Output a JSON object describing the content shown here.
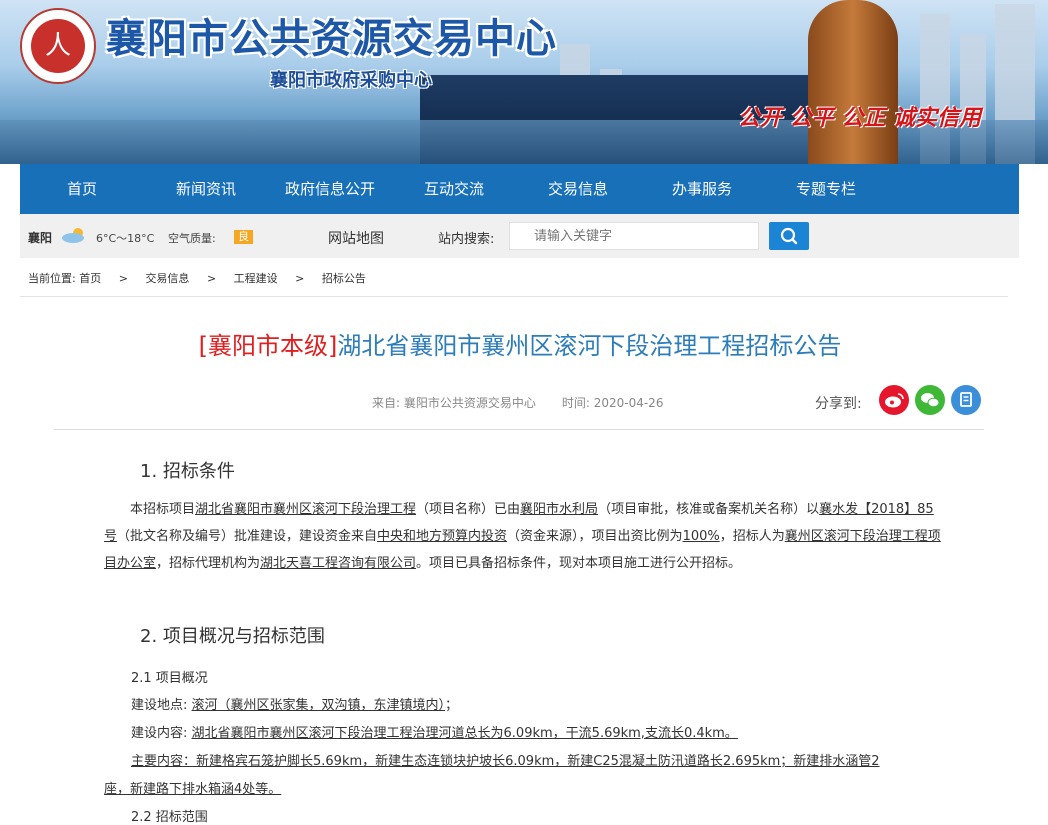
{
  "header": {
    "site_title": "襄阳市公共资源交易中心",
    "site_subtitle": "襄阳市政府采购中心",
    "slogan": "公开 公平 公正 诚实信用",
    "logo_text": "人"
  },
  "nav": [
    "首页",
    "新闻资讯",
    "政府信息公开",
    "互动交流",
    "交易信息",
    "办事服务",
    "专题专栏"
  ],
  "toolbar": {
    "city": "襄阳",
    "temperature": "6°C～18°C",
    "aqi_label": "空气质量:",
    "aqi_value": "良",
    "sitemap": "网站地图",
    "search_label": "站内搜索:",
    "search_placeholder": "请输入关键字"
  },
  "breadcrumb": {
    "prefix": "当前位置:",
    "items": [
      "首页",
      "交易信息",
      "工程建设",
      "招标公告"
    ],
    "separator": ">"
  },
  "article": {
    "title_tag": "[襄阳市本级]",
    "title": "湖北省襄阳市襄州区滚河下段治理工程招标公告",
    "source": "来自: 襄阳市公共资源交易中心",
    "time": "时间: 2020-04-26",
    "share_label": "分享到:",
    "section1": "1. 招标条件",
    "para1": {
      "t1": "本招标项目",
      "project": "湖北省襄阳市襄州区滚河下段治理工程",
      "t2": "（项目名称）已由",
      "approver": "襄阳市水利局",
      "t3": "（项目审批，核准或备案机关名称）以",
      "doc_no": "襄水发【2018】85号",
      "t4": "（批文名称及编号）批准建设，建设资金来自",
      "fund": "中央和地方预算内投资",
      "t5": "（资金来源），项目出资比例为",
      "ratio": "100%",
      "t6": "，招标人为",
      "tenderer": "襄州区滚河下段治理工程项目办公室",
      "t7": "，招标代理机构为",
      "agent": "湖北天喜工程咨询有限公司",
      "t8": "。项目已具备招标条件，现对本项目施工进行公开招标。"
    },
    "section2": "2. 项目概况与招标范围",
    "sub21": "2.1 项目概况",
    "location_label": "建设地点:",
    "location": "滚河（襄州区张家集，双沟镇，东津镇境内）",
    "location_end": "；",
    "content_label": "建设内容:",
    "content": "湖北省襄阳市襄州区滚河下段治理工程治理河道总长为6.09km，干流5.69km,支流长0.4km。",
    "main_line1": "主要内容：新建格宾石笼护脚长5.69km，新建生态连锁块护坡长6.09km，新建C25混凝土防汛道路长2.695km；新建排水涵管2",
    "main_line2": "座，新建路下排水箱涵4处等。",
    "sub22": "2.2 招标范围"
  },
  "colors": {
    "nav": "#1770b8",
    "title": "#2c7db8",
    "tag": "#e02020",
    "weibo": "#e6162d",
    "wechat": "#3fb838",
    "other": "#3b8ed8"
  },
  "icons": [
    "weibo-icon",
    "wechat-icon",
    "share-other-icon",
    "search-icon",
    "weather-cloud-icon"
  ]
}
